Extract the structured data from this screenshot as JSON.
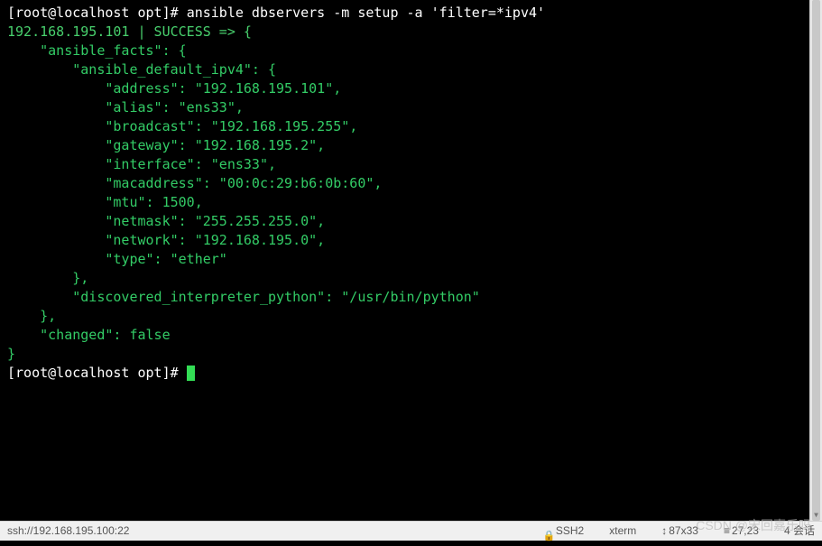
{
  "prompt1": {
    "user_host": "[root@localhost opt]# ",
    "command": "ansible dbservers -m setup -a 'filter=*ipv4'"
  },
  "output": {
    "host_status": "192.168.195.101 | SUCCESS => {",
    "facts_open": "    \"ansible_facts\": {",
    "ipv4_open": "        \"ansible_default_ipv4\": {",
    "address": "            \"address\": \"192.168.195.101\",",
    "alias": "            \"alias\": \"ens33\",",
    "broadcast": "            \"broadcast\": \"192.168.195.255\",",
    "gateway": "            \"gateway\": \"192.168.195.2\",",
    "interface": "            \"interface\": \"ens33\",",
    "macaddress": "            \"macaddress\": \"00:0c:29:b6:0b:60\",",
    "mtu": "            \"mtu\": 1500,",
    "netmask": "            \"netmask\": \"255.255.255.0\",",
    "network": "            \"network\": \"192.168.195.0\",",
    "type": "            \"type\": \"ether\"",
    "ipv4_close": "        },",
    "discovered": "        \"discovered_interpreter_python\": \"/usr/bin/python\"",
    "facts_close": "    },",
    "changed": "    \"changed\": false",
    "root_close": "}"
  },
  "prompt2": {
    "user_host": "[root@localhost opt]# "
  },
  "statusbar": {
    "connection": "ssh://192.168.195.100:22",
    "protocol": "SSH2",
    "term": "xterm",
    "size": "87x33",
    "cursor": "27,23",
    "sessions": "4 会话"
  },
  "watermark": "CSDN @宋回嘉乐吗"
}
